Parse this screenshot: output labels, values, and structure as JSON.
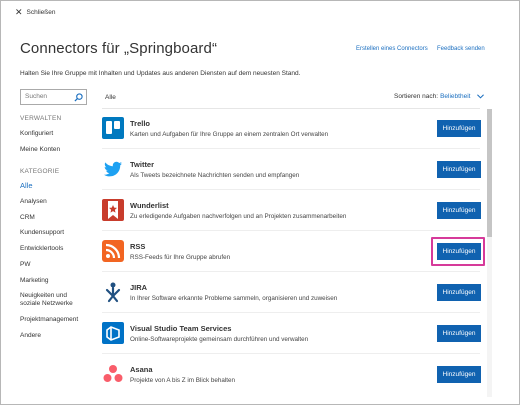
{
  "header": {
    "close_label": "Schließen",
    "title": "Connectors für „Springboard“",
    "link_create": "Erstellen eines Connectors",
    "link_feedback": "Feedback senden",
    "description": "Halten Sie Ihre Gruppe mit Inhalten und Updates aus anderen Diensten auf dem neuesten Stand."
  },
  "search": {
    "placeholder": "Suchen"
  },
  "sidebar": {
    "section_manage": "VERWALTEN",
    "manage_items": [
      {
        "label": "Konfiguriert"
      },
      {
        "label": "Meine Konten"
      }
    ],
    "section_category": "KATEGORIE",
    "category_items": [
      {
        "label": "Alle",
        "active": true
      },
      {
        "label": "Analysen"
      },
      {
        "label": "CRM"
      },
      {
        "label": "Kundensupport"
      },
      {
        "label": "Entwicklertools"
      },
      {
        "label": "PW"
      },
      {
        "label": "Marketing"
      },
      {
        "label": "Neuigkeiten und\nsoziale Netzwerke"
      },
      {
        "label": "Projektmanagement"
      },
      {
        "label": "Andere"
      }
    ]
  },
  "list": {
    "filter_label": "Alle",
    "sort_prefix": "Sortieren nach:",
    "sort_value": "Beliebtheit",
    "add_label": "Hinzufügen",
    "connectors": [
      {
        "name": "Trello",
        "description": "Karten und Aufgaben für Ihre Gruppe an einem zentralen Ort verwalten",
        "icon": "trello-icon",
        "color": "#0079bf"
      },
      {
        "name": "Twitter",
        "description": "Als Tweets bezeichnete Nachrichten senden und empfangen",
        "icon": "twitter-icon",
        "color": "#1da1f2"
      },
      {
        "name": "Wunderlist",
        "description": "Zu erledigende Aufgaben nachverfolgen und an Projekten zusammenarbeiten",
        "icon": "wunderlist-icon",
        "color": "#c83c2c"
      },
      {
        "name": "RSS",
        "description": "RSS-Feeds für Ihre Gruppe abrufen",
        "icon": "rss-icon",
        "color": "#f26522",
        "highlighted": true
      },
      {
        "name": "JIRA",
        "description": "In Ihrer Software erkannte Probleme sammeln, organisieren und zuweisen",
        "icon": "jira-icon",
        "color": "#205081"
      },
      {
        "name": "Visual Studio Team Services",
        "description": "Online-Softwareprojekte gemeinsam durchführen und verwalten",
        "icon": "vsts-icon",
        "color": "#0072c6"
      },
      {
        "name": "Asana",
        "description": "Projekte von A bis Z im Blick behalten",
        "icon": "asana-icon",
        "color": "#f95d6a"
      }
    ]
  },
  "colors": {
    "accent": "#1062b0",
    "link": "#1b6fc0",
    "highlight": "#d63a9a"
  }
}
